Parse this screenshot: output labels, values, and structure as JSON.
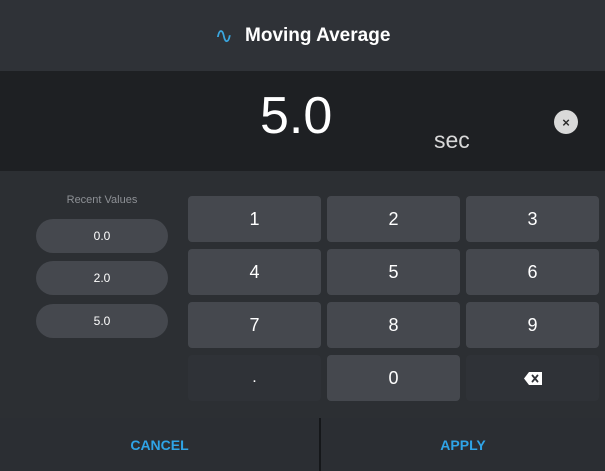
{
  "header": {
    "title": "Moving Average",
    "icon": "sine-wave-icon",
    "icon_glyph": "∿",
    "accent_color": "#3aa7e0"
  },
  "display": {
    "value": "5.0",
    "unit": "sec",
    "clear_icon": "clear-icon",
    "clear_glyph": "×"
  },
  "recent": {
    "title": "Recent Values",
    "values": [
      "0.0",
      "2.0",
      "5.0"
    ]
  },
  "keypad": {
    "keys": [
      "1",
      "2",
      "3",
      "4",
      "5",
      "6",
      "7",
      "8",
      "9",
      ".",
      "0"
    ],
    "backspace_icon": "backspace-icon"
  },
  "footer": {
    "cancel_label": "CANCEL",
    "apply_label": "APPLY",
    "accent_color": "#2fa4e7"
  }
}
